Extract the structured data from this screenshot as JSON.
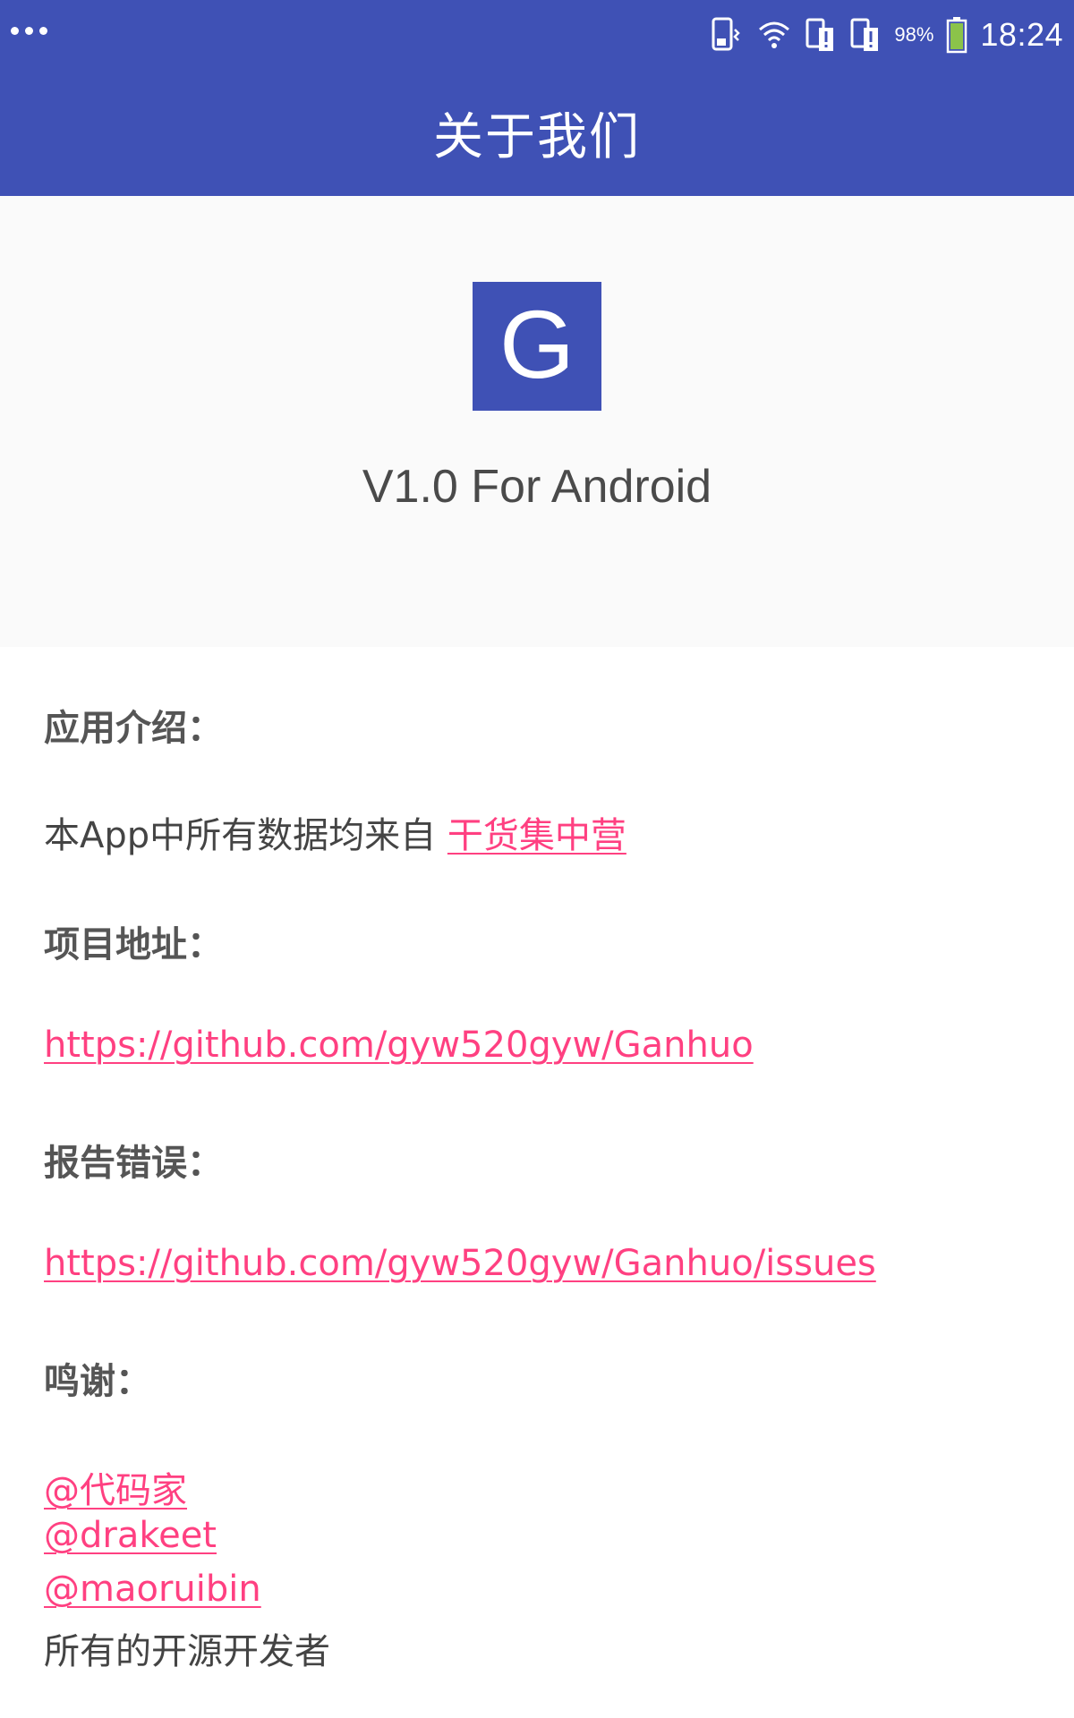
{
  "status_bar": {
    "battery_percent": "98%",
    "time": "18:24",
    "icons": [
      "more-dots-icon",
      "vibrate-icon",
      "wifi-icon",
      "sim-alert-icon",
      "sim-alert-icon",
      "battery-icon"
    ]
  },
  "toolbar": {
    "title": "关于我们"
  },
  "header": {
    "logo_letter": "G",
    "version": "V1.0 For Android"
  },
  "sections": {
    "intro_label": "应用介绍：",
    "intro_text": "本App中所有数据均来自",
    "intro_link": "干货集中营",
    "project_label": "项目地址：",
    "project_link": "https://github.com/gyw520gyw/Ganhuo",
    "report_label": "报告错误：",
    "report_link": "https://github.com/gyw520gyw/Ganhuo/issues",
    "thanks_label": "鸣谢：",
    "thanks_links": [
      "@代码家",
      "@drakeet",
      "@maoruibin"
    ],
    "thanks_text": "所有的开源开发者"
  },
  "colors": {
    "primary": "#3f51b5",
    "accent": "#ff4081",
    "header_bg": "#fafafa"
  }
}
